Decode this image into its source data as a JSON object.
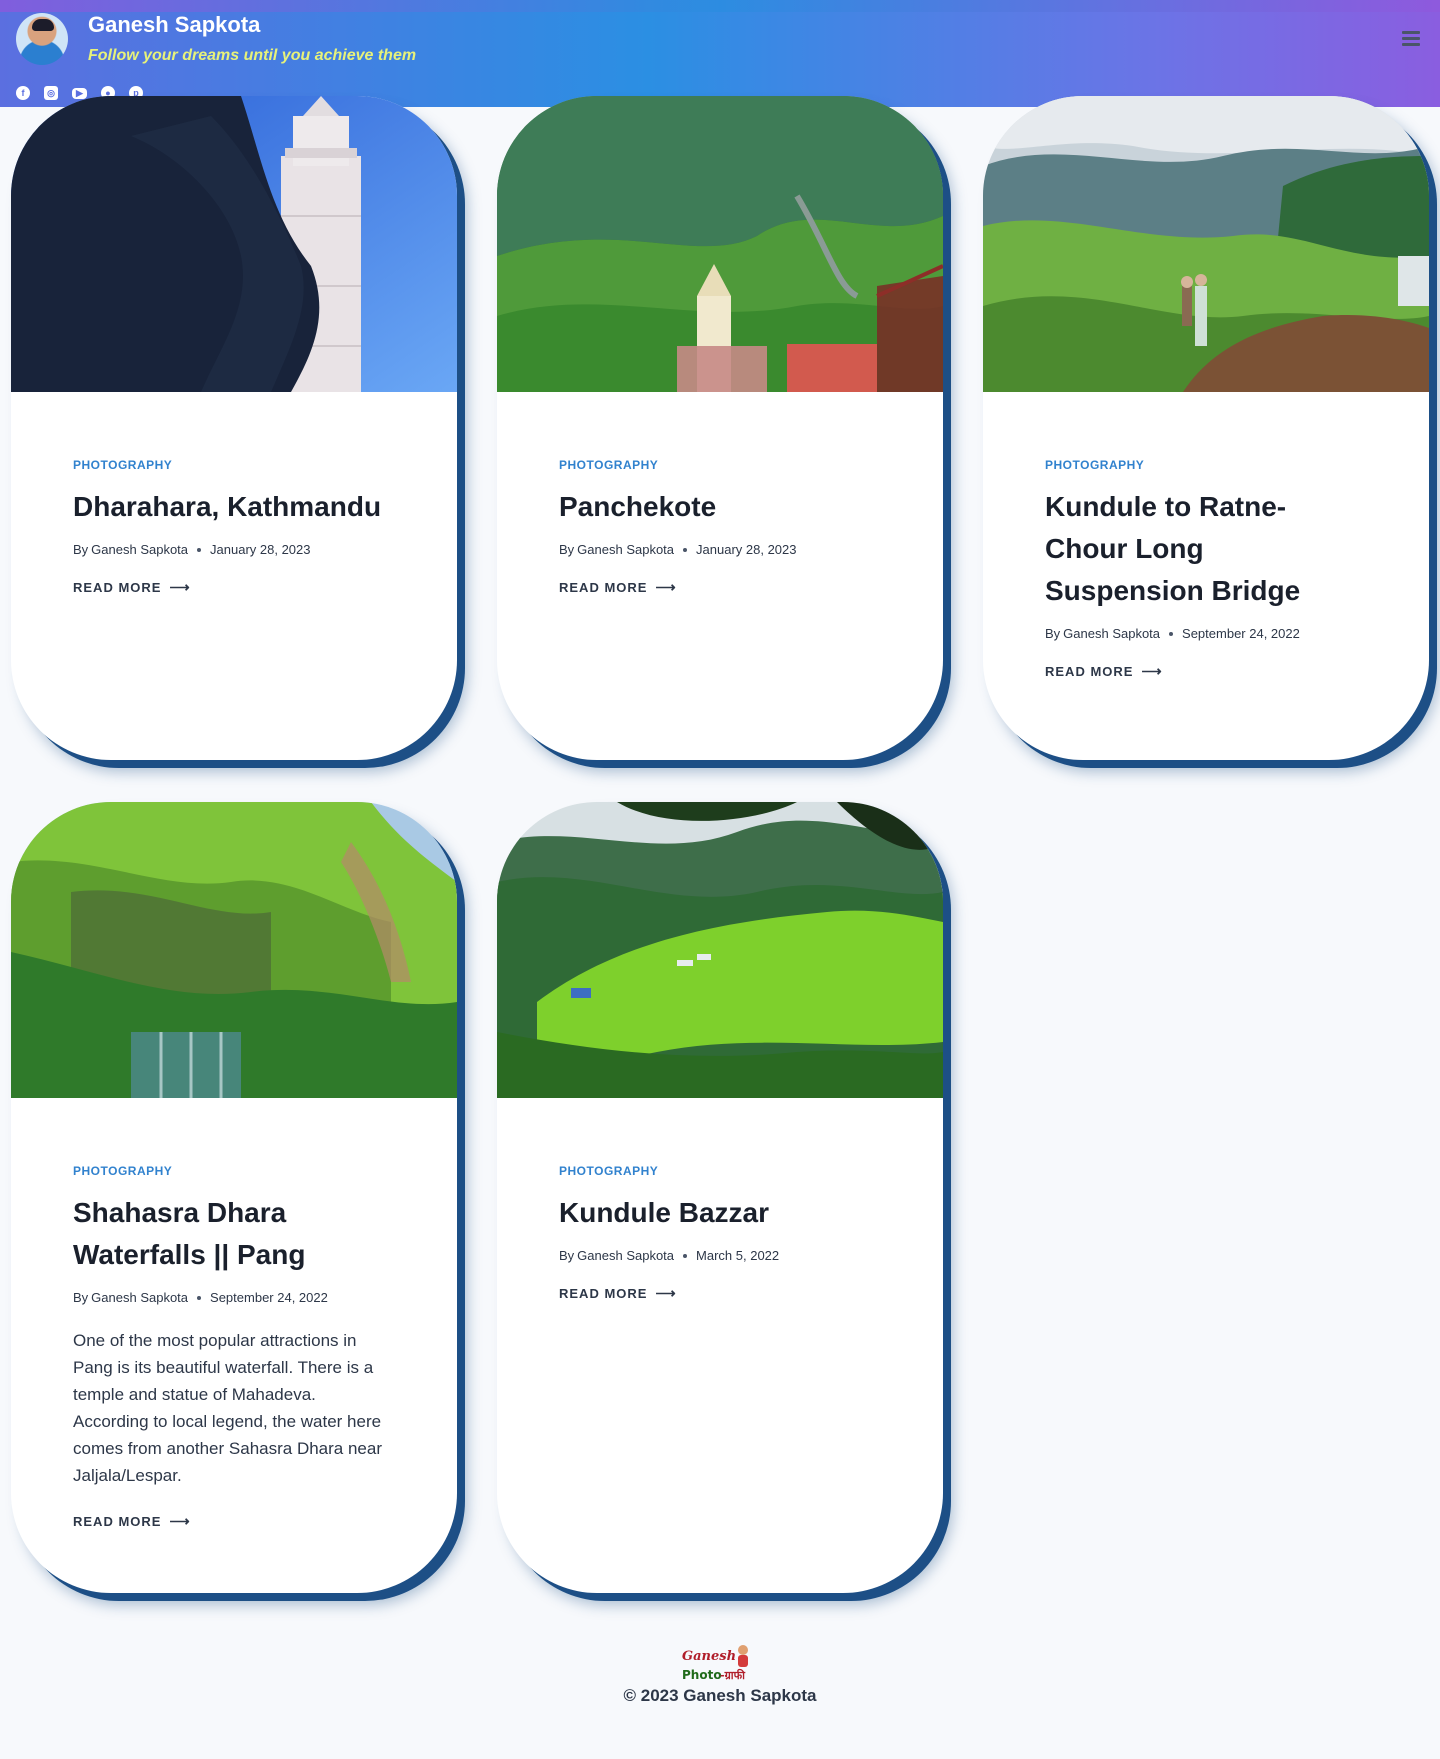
{
  "header": {
    "site_title": "Ganesh Sapkota",
    "tagline": "Follow your dreams until you achieve them",
    "socials": [
      {
        "icon": "facebook-icon"
      },
      {
        "icon": "instagram-icon"
      },
      {
        "icon": "youtube-icon"
      },
      {
        "icon": "github-icon"
      },
      {
        "icon": "pinterest-icon"
      }
    ],
    "menu_icon": "hamburger-menu-icon"
  },
  "posts": [
    {
      "category": "PHOTOGRAPHY",
      "title": "Dharahara, Kathmandu",
      "by": "By",
      "author": "Ganesh Sapkota",
      "date": "January 28, 2023",
      "excerpt": "",
      "read_more": "READ MORE",
      "arrow": "⟶"
    },
    {
      "category": "PHOTOGRAPHY",
      "title": "Panchekote",
      "by": "By",
      "author": "Ganesh Sapkota",
      "date": "January 28, 2023",
      "excerpt": "",
      "read_more": "READ MORE",
      "arrow": "⟶"
    },
    {
      "category": "PHOTOGRAPHY",
      "title": "Kundule to Ratne-Chour Long Suspension Bridge",
      "by": "By",
      "author": "Ganesh Sapkota",
      "date": "September 24, 2022",
      "excerpt": "",
      "read_more": "READ MORE",
      "arrow": "⟶"
    },
    {
      "category": "PHOTOGRAPHY",
      "title": "Shahasra Dhara Waterfalls || Pang",
      "by": "By",
      "author": "Ganesh Sapkota",
      "date": "September 24, 2022",
      "excerpt": "One of the most popular attractions in Pang is its beautiful waterfall. There is a temple and statue of Mahadeva. According to local legend, the water here comes from another Sahasra Dhara near Jaljala/Lespar.",
      "read_more": "READ MORE",
      "arrow": "⟶"
    },
    {
      "category": "PHOTOGRAPHY",
      "title": "Kundule Bazzar",
      "by": "By",
      "author": "Ganesh Sapkota",
      "date": "March 5, 2022",
      "excerpt": "",
      "read_more": "READ MORE",
      "arrow": "⟶"
    }
  ],
  "footer": {
    "logo_text_1": "Ganesh",
    "logo_text_2": "Photo-ग्राफी",
    "copyright": "© 2023 Ganesh Sapkota"
  },
  "colors": {
    "accent": "#3182ce",
    "shadow": "#1d4f86",
    "tagline": "#e7f27a"
  }
}
